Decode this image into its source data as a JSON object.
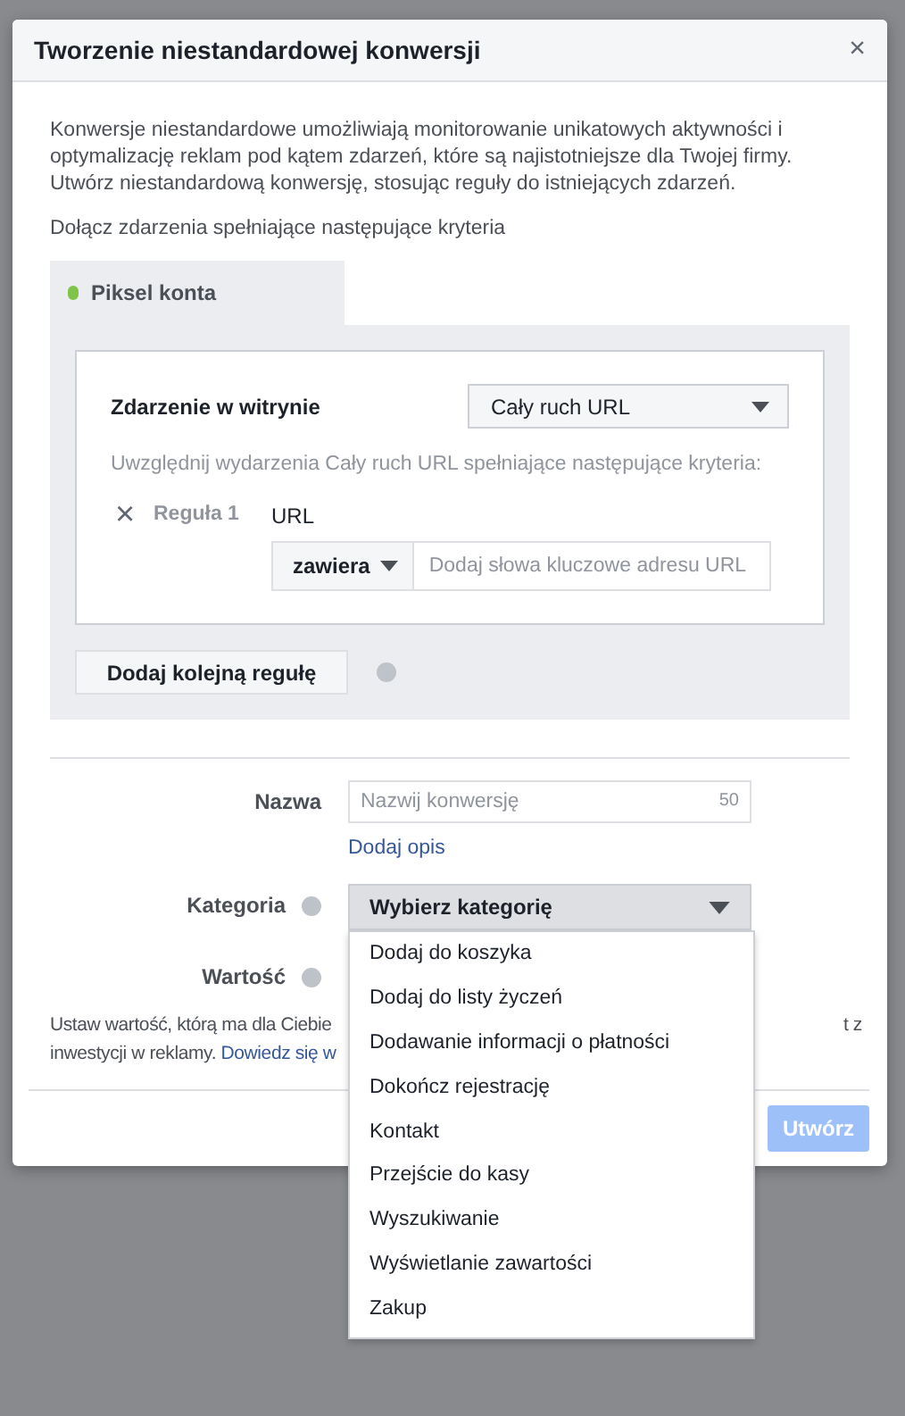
{
  "dialog": {
    "title": "Tworzenie niestandardowej konwersji",
    "close": "×"
  },
  "intro": "Konwersje niestandardowe umożliwiają monitorowanie unikatowych aktywności i optymalizację reklam pod kątem zdarzeń, które są najistotniejsze dla Twojej firmy. Utwórz niestandardową konwersję, stosując reguły do istniejących zdarzeń.",
  "criteria_heading": "Dołącz zdarzenia spełniające następujące kryteria",
  "pixel_tab": {
    "label": "Piksel konta"
  },
  "event": {
    "label": "Zdarzenie w witrynie",
    "value": "Cały ruch URL"
  },
  "event_hint": "Uwzględnij wydarzenia Cały ruch URL spełniające następujące kryteria:",
  "rules": [
    {
      "remove": "×",
      "label": "Reguła 1",
      "field": "URL",
      "operator": "zawiera",
      "placeholder": "Dodaj słowa kluczowe adresu URL"
    }
  ],
  "add_rule_button": "Dodaj kolejną regułę",
  "name": {
    "label": "Nazwa",
    "placeholder": "Nazwij konwersję",
    "counter": "50",
    "link": "Dodaj opis"
  },
  "category": {
    "label": "Kategoria",
    "value": "Wybierz kategorię",
    "expanded": true,
    "options": [
      "Dodaj do koszyka",
      "Dodaj do listy życzeń",
      "Dodawanie informacji o płatności",
      "Dokończ rejestrację",
      "Kontakt",
      "Przejście do kasy",
      "Wyszukiwanie",
      "Wyświetlanie zawartości",
      "Zakup"
    ]
  },
  "value": {
    "label": "Wartość"
  },
  "value_note": {
    "line_1": "Ustaw wartość, którą ma dla Ciebie",
    "line_2": "inwestycji w reklamy.",
    "link": "Dowiedz się w",
    "right_fragment": "t z"
  },
  "footer": {
    "create_button": "Utwórz",
    "create_disabled": true
  }
}
